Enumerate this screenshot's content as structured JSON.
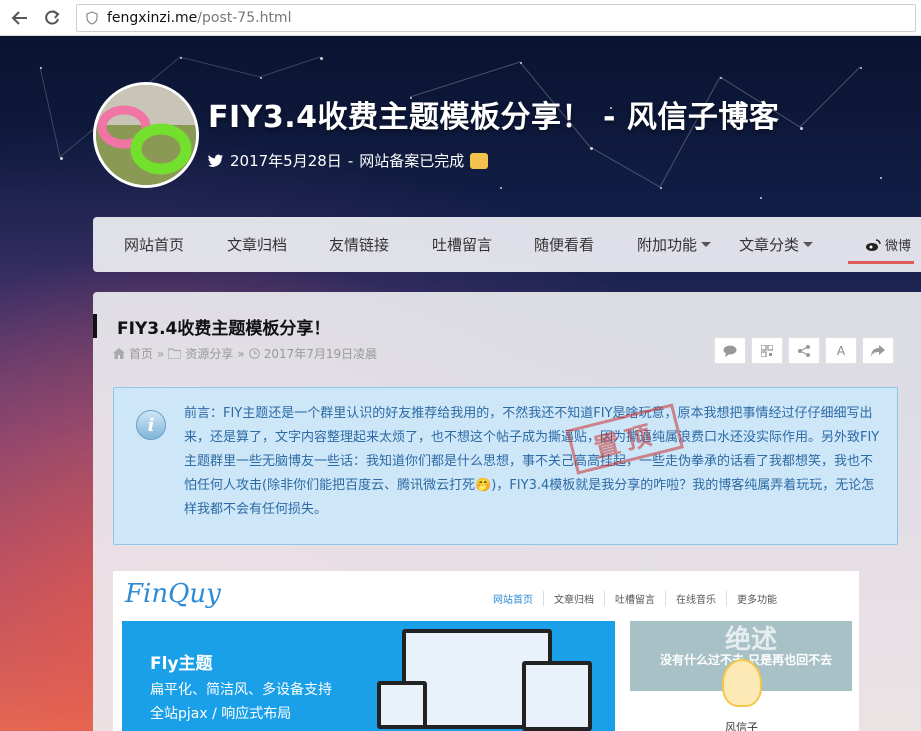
{
  "browser": {
    "url_host": "fengxinzi.me",
    "url_path": "/post-75.html"
  },
  "header": {
    "title": "FIY3.4收费主题模板分享！ - 风信子博客",
    "date": "2017年5月28日",
    "separator": "-",
    "status": "网站备案已完成"
  },
  "nav": {
    "items": [
      {
        "label": "网站首页"
      },
      {
        "label": "文章归档"
      },
      {
        "label": "友情链接"
      },
      {
        "label": "吐槽留言"
      },
      {
        "label": "随便看看"
      },
      {
        "label": "附加功能"
      },
      {
        "label": "文章分类"
      }
    ],
    "weibo": "微博"
  },
  "post": {
    "title": "FIY3.4收费主题模板分享！",
    "breadcrumb": {
      "home": "首页",
      "sep": "»",
      "category": "资源分享",
      "date": "2017年7月19日凌晨"
    },
    "tools": [
      "comment-icon",
      "qrcode-icon",
      "share-icon",
      "font-icon",
      "forward-icon"
    ],
    "tool_font_label": "A",
    "notice": {
      "text": "前言：FIY主题还是一个群里认识的好友推荐给我用的，不然我还不知道FIY是啥玩意，原本我想把事情经过仔仔细细写出来，还是算了，文字内容整理起来太烦了，也不想这个帖子成为撕逼贴，因为撕逼纯属浪费口水还没实际作用。另外致FIY主题群里一些无脑博友一些话：我知道你们都是什么思想，事不关己高高挂起，一些走伪拳承的话看了我都想笑，我也不怕任何人攻击(除非你们能把百度云、腾讯微云打死🤭)，FIY3.4模板就是我分享的咋啦？我的博客纯属弄着玩玩，无论怎样我都不会有任何损失。",
      "stamp": "置顶"
    }
  },
  "embedded": {
    "logo": "FinQuy",
    "nav": [
      "网站首页",
      "文章归档",
      "吐槽留言",
      "在线音乐",
      "更多功能"
    ],
    "banner_title": "Fly主题",
    "banner_line1": "扁平化、简洁风、多设备支持",
    "banner_line2": "全站pjax / 响应式布局",
    "side_big": "绝述",
    "side_text": "没有什么过不去 只是再也回不去",
    "side_name": "风信子"
  }
}
